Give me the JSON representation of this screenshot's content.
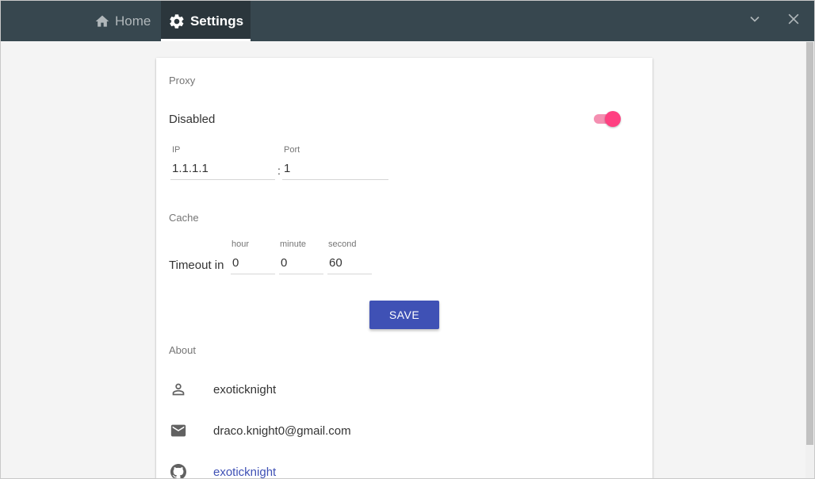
{
  "tabs": [
    {
      "label": "Home",
      "icon": "home-icon",
      "active": false
    },
    {
      "label": "Settings",
      "icon": "gear-icon",
      "active": true
    }
  ],
  "window_controls": {
    "minimize_icon": "chevron-down-icon",
    "close_icon": "close-icon"
  },
  "proxy": {
    "section_title": "Proxy",
    "status_label": "Disabled",
    "enabled": true,
    "ip_label": "IP",
    "ip_value": "1.1.1.1",
    "separator": ":",
    "port_label": "Port",
    "port_value": "1"
  },
  "cache": {
    "section_title": "Cache",
    "timeout_label": "Timeout in",
    "hour_label": "hour",
    "hour_value": "0",
    "minute_label": "minute",
    "minute_value": "0",
    "second_label": "second",
    "second_value": "60"
  },
  "save_label": "SAVE",
  "about": {
    "section_title": "About",
    "username": "exoticknight",
    "email": "draco.knight0@gmail.com",
    "github": "exoticknight"
  },
  "colors": {
    "titlebar": "#37474f",
    "accent": "#3f51b5",
    "toggle_on": "#ff4081"
  }
}
